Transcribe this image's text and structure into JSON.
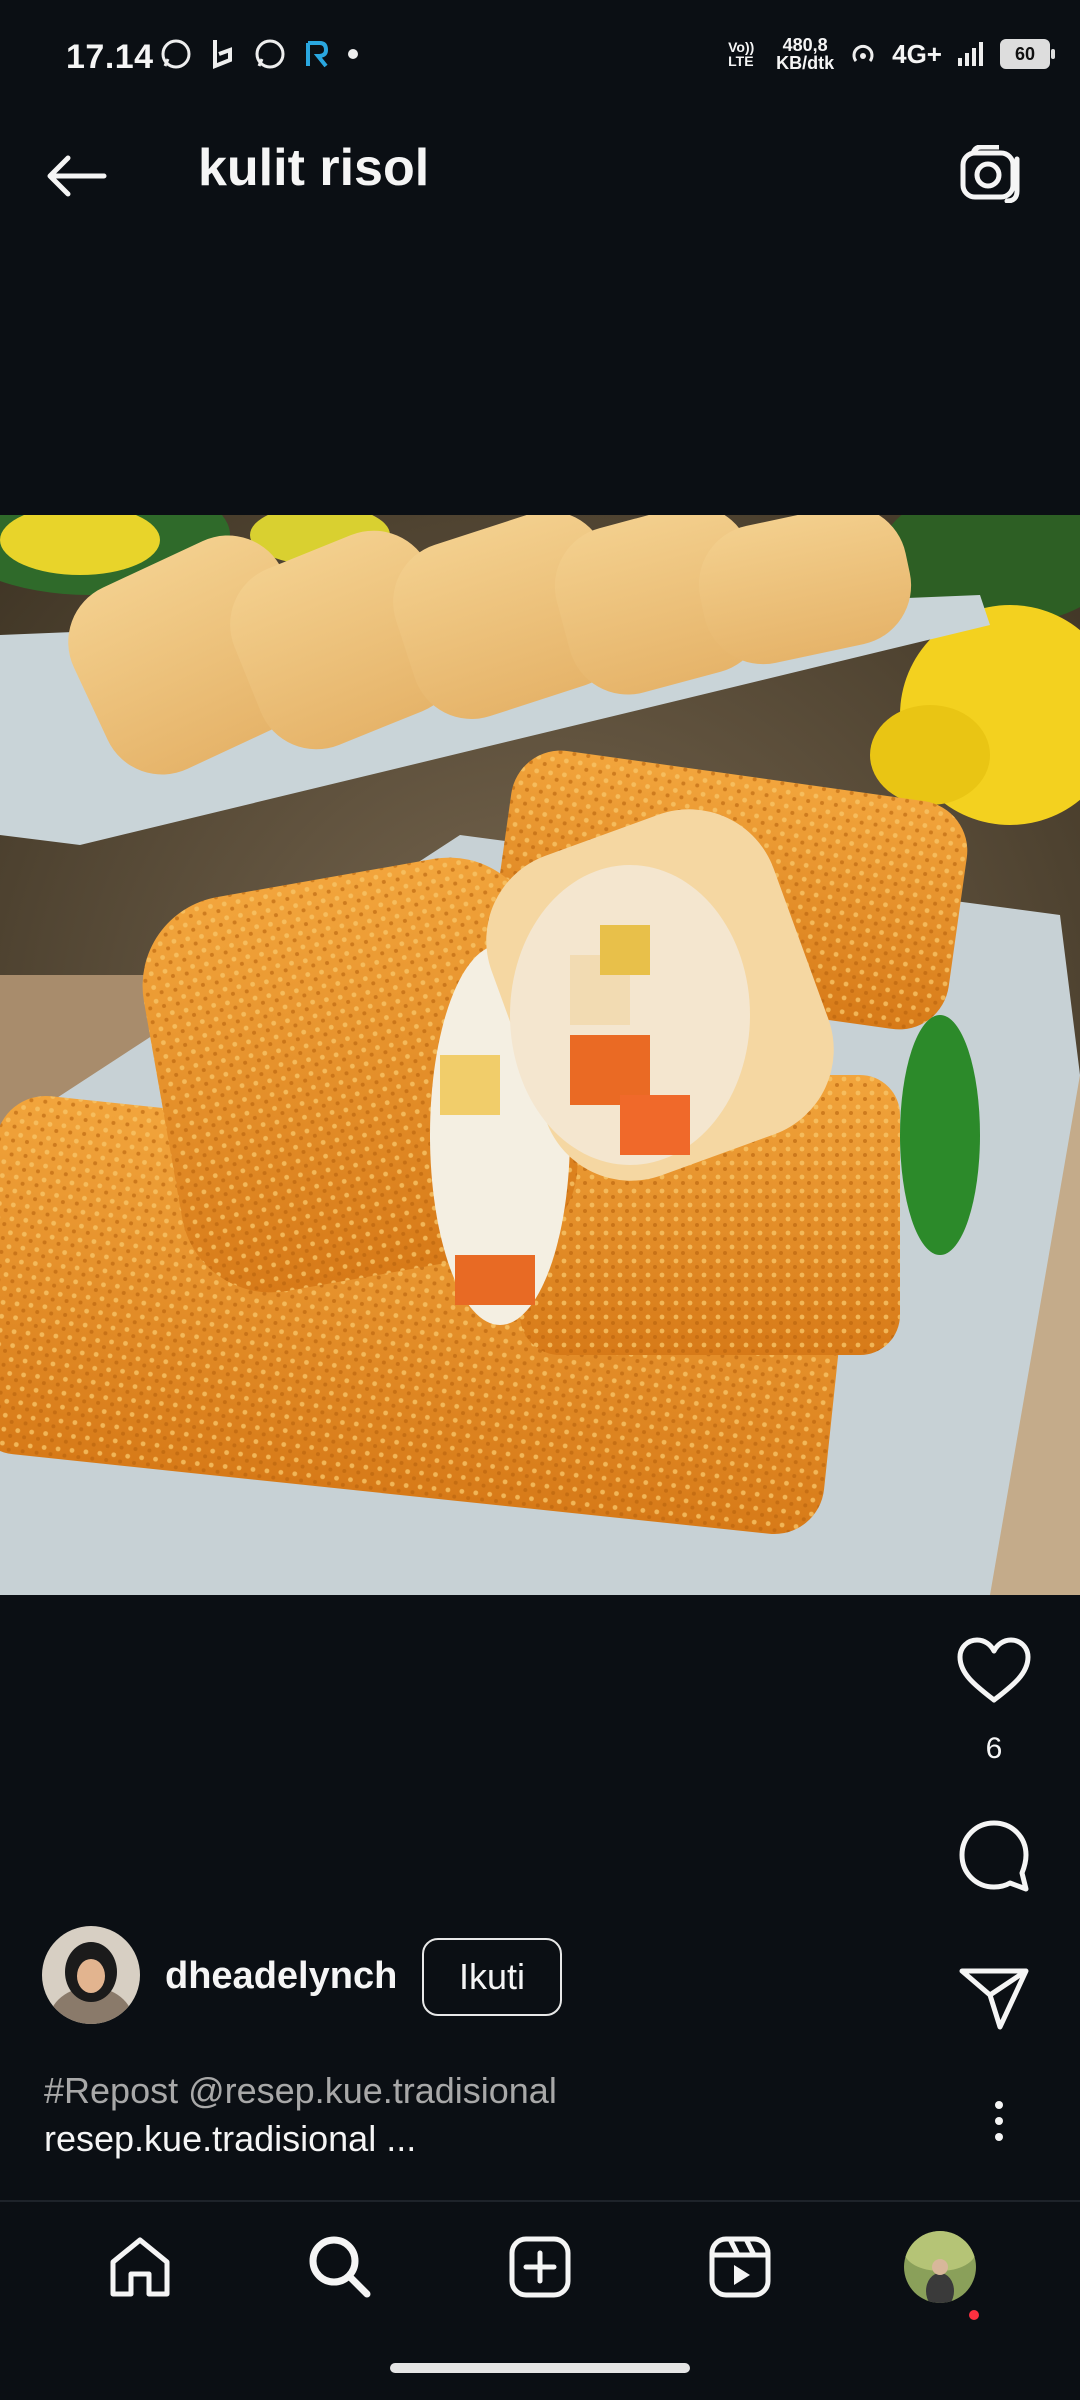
{
  "status": {
    "time": "17.14",
    "net_type": "Vo)) LTE",
    "net_speed_value": "480,8",
    "net_speed_unit": "KB/dtk",
    "network": "4G+",
    "battery": "60",
    "left_icons": [
      "whatsapp-icon",
      "b-icon",
      "whatsapp-icon",
      "r-icon",
      "dot-icon"
    ]
  },
  "header": {
    "title": "kulit risol"
  },
  "post": {
    "likes": "6",
    "username": "dheadelynch",
    "follow_label": "Ikuti",
    "caption_line1": "#Repost @resep.kue.tradisional",
    "caption_line2": "resep.kue.tradisional ..."
  },
  "nav": {
    "items": [
      "home-icon",
      "search-icon",
      "create-icon",
      "reels-icon",
      "profile-avatar"
    ]
  }
}
